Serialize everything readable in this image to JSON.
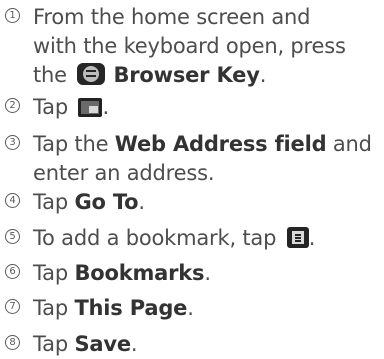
{
  "steps": [
    {
      "num": "1",
      "lines": [
        [
          "From the home screen and"
        ],
        [
          "with the keyboard open, press"
        ],
        [
          "the ",
          {
            "icon": "browser-key-icon"
          },
          {
            "b": " Browser Key"
          },
          "."
        ]
      ]
    },
    {
      "num": "2",
      "lines": [
        [
          "Tap ",
          {
            "icon": "window-icon"
          },
          "."
        ]
      ]
    },
    {
      "num": "3",
      "lines": [
        [
          "Tap the ",
          {
            "b": "Web Address field"
          },
          " and"
        ],
        [
          "enter an address."
        ]
      ]
    },
    {
      "num": "4",
      "lines": [
        [
          "Tap ",
          {
            "b": "Go To"
          },
          "."
        ]
      ]
    },
    {
      "num": "5",
      "lines": [
        [
          "To add a bookmark, tap ",
          {
            "icon": "menu-icon"
          },
          "."
        ]
      ]
    },
    {
      "num": "6",
      "lines": [
        [
          "Tap ",
          {
            "b": "Bookmarks"
          },
          "."
        ]
      ]
    },
    {
      "num": "7",
      "lines": [
        [
          "Tap ",
          {
            "b": "This Page"
          },
          "."
        ]
      ]
    },
    {
      "num": "8",
      "lines": [
        [
          "Tap ",
          {
            "b": "Save"
          },
          "."
        ]
      ]
    }
  ]
}
